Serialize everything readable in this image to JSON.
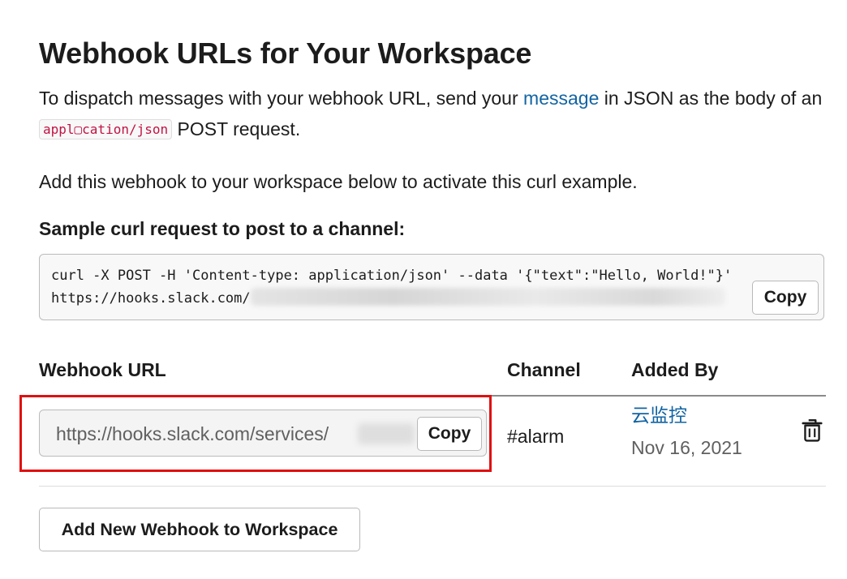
{
  "title": "Webhook URLs for Your Workspace",
  "intro": {
    "before_link": "To dispatch messages with your webhook URL, send your ",
    "link": "message",
    "after_link": " in JSON as the body of an ",
    "code": "appl▢cation/json",
    "after_code": " POST request."
  },
  "activate_text": "Add this webhook to your workspace below to activate this curl example.",
  "sample": {
    "label": "Sample curl request to post to a channel:",
    "line1": "curl -X POST -H 'Content-type: application/json' --data '{\"text\":\"Hello, World!\"}'",
    "line2_prefix": "https://hooks.slack.com/",
    "copy_label": "Copy"
  },
  "table": {
    "headers": {
      "url": "Webhook URL",
      "channel": "Channel",
      "added_by": "Added By"
    },
    "rows": [
      {
        "url": "https://hooks.slack.com/services/",
        "copy_label": "Copy",
        "channel": "#alarm",
        "added_by": "云监控",
        "date": "Nov 16, 2021",
        "delete_icon": "trash-icon"
      }
    ]
  },
  "add_button": "Add New Webhook to Workspace",
  "colors": {
    "link": "#1264a3",
    "code": "#c01343",
    "highlight": "#e01010"
  }
}
